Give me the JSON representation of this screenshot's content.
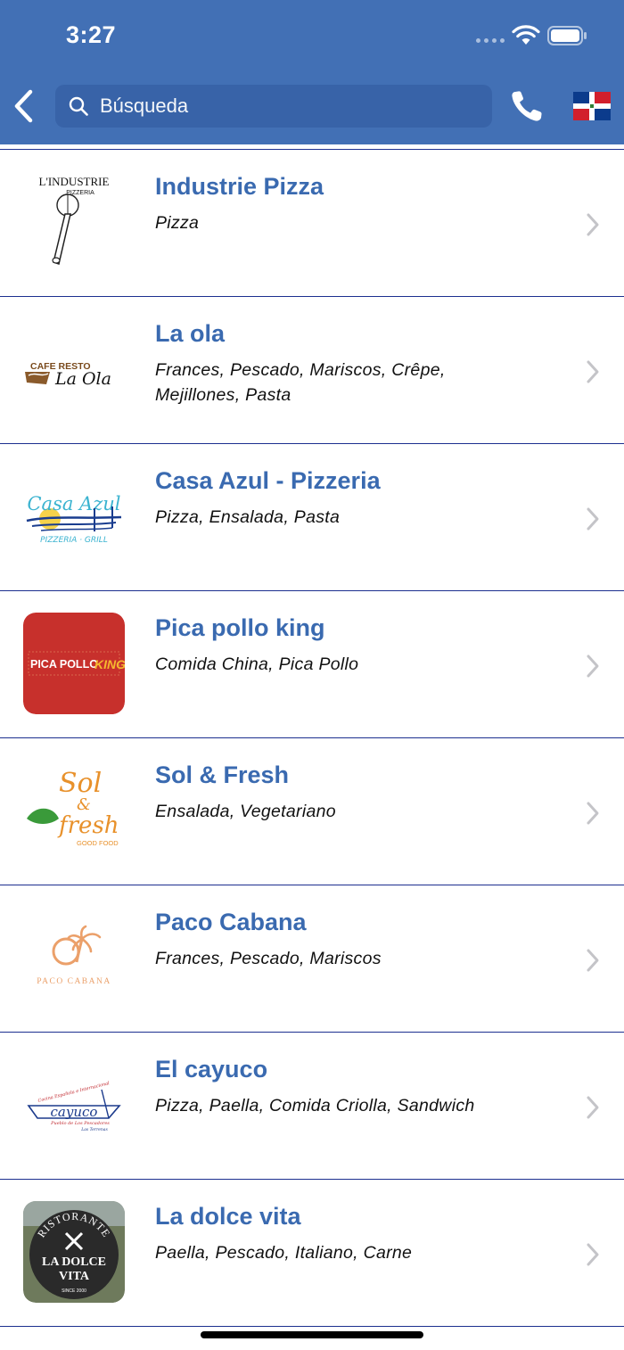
{
  "status_bar": {
    "time": "3:27"
  },
  "nav": {
    "search_placeholder": "Búsqueda",
    "icons": {
      "back": "chevron-left-icon",
      "search": "magnifier-icon",
      "call": "phone-icon",
      "language": "dominican-republic-flag-icon"
    }
  },
  "colors": {
    "header": "#4270b5",
    "search_bg": "#3863a8",
    "title": "#3a6ab0",
    "divider": "#1c2f8f"
  },
  "restaurants": [
    {
      "name": "Industrie Pizza",
      "cuisines": "Pizza",
      "logo_text": [
        "L'INDUSTRIE",
        "PIZZERIA"
      ]
    },
    {
      "name": "La ola",
      "cuisines": "Frances, Pescado, Mariscos, Crêpe, Mejillones, Pasta",
      "logo_text": [
        "CAFE RESTO",
        "La Ola"
      ]
    },
    {
      "name": "Casa Azul - Pizzeria",
      "cuisines": "Pizza, Ensalada, Pasta",
      "logo_text": [
        "Casa Azul",
        "PIZZERIA · GRILL"
      ]
    },
    {
      "name": "Pica pollo king",
      "cuisines": "Comida China, Pica Pollo",
      "logo_text": [
        "PICA POLLO",
        "KING"
      ]
    },
    {
      "name": "Sol & Fresh",
      "cuisines": "Ensalada, Vegetariano",
      "logo_text": [
        "Sol",
        "&",
        "fresh",
        "GOOD FOOD"
      ]
    },
    {
      "name": "Paco Cabana",
      "cuisines": "Frances, Pescado, Mariscos",
      "logo_text": [
        "PACO CABANA"
      ]
    },
    {
      "name": "El cayuco",
      "cuisines": "Pizza, Paella, Comida Criolla, Sandwich",
      "logo_text": [
        "Cocina Española e Internacional",
        "cayuco",
        "Pueblo de Los Pescadores",
        "Las Terrenas"
      ]
    },
    {
      "name": "La dolce vita",
      "cuisines": "Paella, Pescado, Italiano, Carne",
      "logo_text": [
        "RISTORANTE",
        "LA DOLCE",
        "VITA",
        "SINCE 2000"
      ]
    }
  ]
}
